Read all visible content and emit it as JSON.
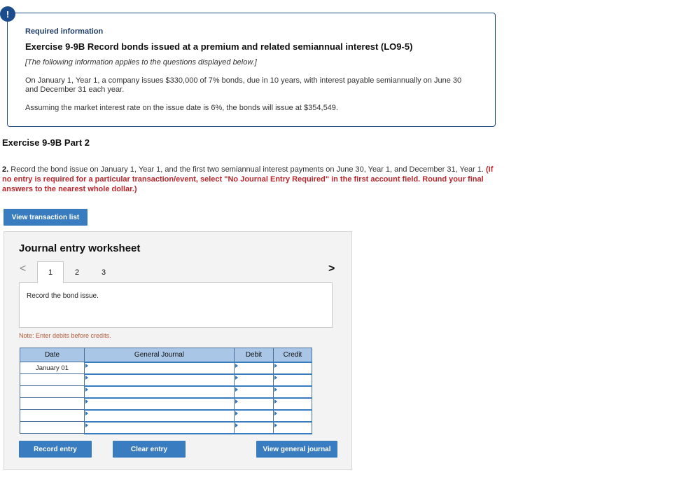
{
  "alert": {
    "icon": "exclamation-icon",
    "symbol": "!"
  },
  "info": {
    "required_label": "Required information",
    "exercise_title": "Exercise 9-9B Record bonds issued at a premium and related semiannual interest (LO9-5)",
    "applies_note": "[The following information applies to the questions displayed below.]",
    "paragraph1": "On January 1, Year 1, a company issues $330,000 of 7% bonds, due in 10 years, with interest payable semiannually on June 30 and December 31 each year.",
    "paragraph2": "Assuming the market interest rate on the issue date is 6%, the bonds will issue at $354,549."
  },
  "part": {
    "title": "Exercise 9-9B Part 2",
    "number": "2.",
    "instruction_text": " Record the bond issue on January 1, Year 1, and the first two semiannual interest payments on June 30, Year 1, and December 31, Year 1. ",
    "instruction_red": "(If no entry is required for a particular transaction/event, select \"No Journal Entry Required\" in the first account field. Round your final answers to the nearest whole dollar.)"
  },
  "buttons": {
    "view_transaction_list": "View transaction list",
    "record_entry": "Record entry",
    "clear_entry": "Clear entry",
    "view_general_journal": "View general journal"
  },
  "worksheet": {
    "title": "Journal entry worksheet",
    "tabs": [
      "1",
      "2",
      "3"
    ],
    "active_tab": "1",
    "prev_symbol": "<",
    "next_symbol": ">",
    "description": "Record the bond issue.",
    "note": "Note: Enter debits before credits.",
    "table": {
      "headers": [
        "Date",
        "General Journal",
        "Debit",
        "Credit"
      ],
      "rows": [
        {
          "date": "January 01",
          "account": "",
          "debit": "",
          "credit": ""
        },
        {
          "date": "",
          "account": "",
          "debit": "",
          "credit": ""
        },
        {
          "date": "",
          "account": "",
          "debit": "",
          "credit": ""
        },
        {
          "date": "",
          "account": "",
          "debit": "",
          "credit": ""
        },
        {
          "date": "",
          "account": "",
          "debit": "",
          "credit": ""
        },
        {
          "date": "",
          "account": "",
          "debit": "",
          "credit": ""
        }
      ]
    }
  },
  "colors": {
    "accent": "#3a7cc0",
    "header_bg": "#a9c6e6",
    "alert_red": "#b8262b",
    "navy": "#1f4e82"
  }
}
